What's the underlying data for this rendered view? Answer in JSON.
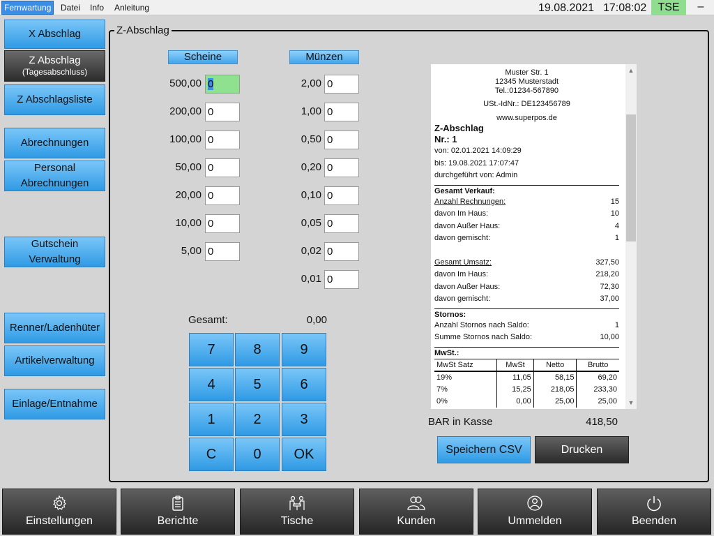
{
  "menu": {
    "items": [
      "Fernwartung",
      "Datei",
      "Info",
      "Anleitung"
    ],
    "date": "19.08.2021",
    "time": "17:08:02",
    "tse": "TSE",
    "minimize": "–"
  },
  "sidebar": {
    "x_abschlag": "X Abschlag",
    "z_abschlag": "Z Abschlag",
    "z_abschlag_sub": "(Tagesabschluss)",
    "z_abschlagsliste": "Z Abschlagsliste",
    "abrechnungen": "Abrechnungen",
    "personal_1": "Personal",
    "personal_2": "Abrechnungen",
    "gutschein_1": "Gutschein",
    "gutschein_2": "Verwaltung",
    "renner": "Renner/Ladenhüter",
    "artikel": "Artikelverwaltung",
    "einlage": "Einlage/Entnahme"
  },
  "panel": {
    "title": "Z-Abschlag",
    "scheine_header": "Scheine",
    "muenzen_header": "Münzen",
    "scheine": [
      {
        "label": "500,00",
        "value": "0"
      },
      {
        "label": "200,00",
        "value": "0"
      },
      {
        "label": "100,00",
        "value": "0"
      },
      {
        "label": "50,00",
        "value": "0"
      },
      {
        "label": "20,00",
        "value": "0"
      },
      {
        "label": "10,00",
        "value": "0"
      },
      {
        "label": "5,00",
        "value": "0"
      }
    ],
    "muenzen": [
      {
        "label": "2,00",
        "value": "0"
      },
      {
        "label": "1,00",
        "value": "0"
      },
      {
        "label": "0,50",
        "value": "0"
      },
      {
        "label": "0,20",
        "value": "0"
      },
      {
        "label": "0,10",
        "value": "0"
      },
      {
        "label": "0,05",
        "value": "0"
      },
      {
        "label": "0,02",
        "value": "0"
      },
      {
        "label": "0,01",
        "value": "0"
      }
    ],
    "gesamt_label": "Gesamt:",
    "gesamt_value": "0,00",
    "keypad": [
      "7",
      "8",
      "9",
      "4",
      "5",
      "6",
      "1",
      "2",
      "3",
      "C",
      "0",
      "OK"
    ],
    "bar_label": "BAR in Kasse",
    "bar_value": "418,50",
    "csv_button": "Speichern CSV",
    "print_button": "Drucken"
  },
  "receipt": {
    "address_1": "Muster Str. 1",
    "address_2": "12345 Musterstadt",
    "phone": "Tel.:01234-567890",
    "ust": "USt.-IdNr.: DE123456789",
    "web": "www.superpos.de",
    "title": "Z-Abschlag",
    "nr": "Nr.: 1",
    "von": "von: 02.01.2021 14:09:29",
    "bis": "bis: 19.08.2021 17:07:47",
    "durch": "durchgeführt von: Admin",
    "gesamt_verkauf": "Gesamt Verkauf:",
    "anzahl_label": "Anzahl Rechnungen:",
    "anzahl_value": "15",
    "im_haus_label": "davon Im Haus:",
    "im_haus_value": "10",
    "ausser_haus_label": "davon Außer Haus:",
    "ausser_haus_value": "4",
    "gemischt_label": "davon gemischt:",
    "gemischt_value": "1",
    "umsatz_label": "Gesamt Umsatz:",
    "umsatz_value": "327,50",
    "u_im_haus_label": "davon Im Haus:",
    "u_im_haus_value": "218,20",
    "u_ausser_haus_label": "davon Außer Haus:",
    "u_ausser_haus_value": "72,30",
    "u_gemischt_label": "davon gemischt:",
    "u_gemischt_value": "37,00",
    "stornos": "Stornos:",
    "stornos_anzahl_label": "Anzahl Stornos nach Saldo:",
    "stornos_anzahl_value": "1",
    "stornos_summe_label": "Summe Stornos nach Saldo:",
    "stornos_summe_value": "10,00",
    "mwst": "MwSt.:",
    "mwst_headers": [
      "MwSt Satz",
      "MwSt",
      "Netto",
      "Brutto"
    ],
    "mwst_rows": [
      [
        "19%",
        "11,05",
        "58,15",
        "69,20"
      ],
      [
        "7%",
        "15,25",
        "218,05",
        "233,30"
      ],
      [
        "0%",
        "0,00",
        "25,00",
        "25,00"
      ]
    ]
  },
  "bottom": {
    "einstellungen": "Einstellungen",
    "berichte": "Berichte",
    "tische": "Tische",
    "kunden": "Kunden",
    "ummelden": "Ummelden",
    "beenden": "Beenden"
  }
}
